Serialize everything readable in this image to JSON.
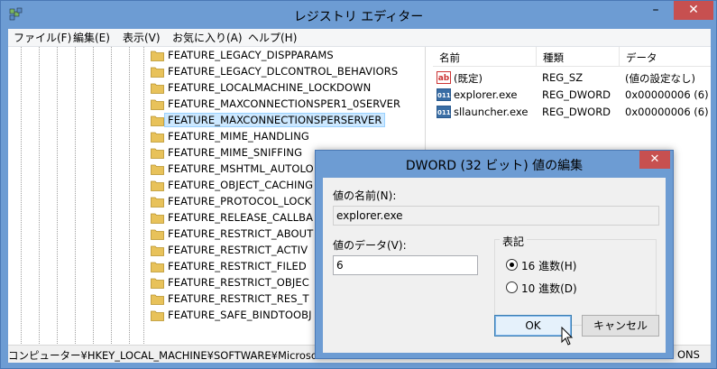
{
  "window": {
    "title": "レジストリ エディター",
    "minimize": "–",
    "maximize": "□",
    "close": "✕"
  },
  "menu": [
    "ファイル(F)",
    "編集(E)",
    "表示(V)",
    "お気に入り(A)",
    "ヘルプ(H)"
  ],
  "tree": {
    "items": [
      "FEATURE_LEGACY_DISPPARAMS",
      "FEATURE_LEGACY_DLCONTROL_BEHAVIORS",
      "FEATURE_LOCALMACHINE_LOCKDOWN",
      "FEATURE_MAXCONNECTIONSPER1_0SERVER",
      "FEATURE_MAXCONNECTIONSPERSERVER",
      "FEATURE_MIME_HANDLING",
      "FEATURE_MIME_SNIFFING",
      "FEATURE_MSHTML_AUTOLO",
      "FEATURE_OBJECT_CACHING",
      "FEATURE_PROTOCOL_LOCK",
      "FEATURE_RELEASE_CALLBA",
      "FEATURE_RESTRICT_ABOUT",
      "FEATURE_RESTRICT_ACTIV",
      "FEATURE_RESTRICT_FILED",
      "FEATURE_RESTRICT_OBJEC",
      "FEATURE_RESTRICT_RES_T",
      "FEATURE_SAFE_BINDTOOBJ"
    ],
    "selected_index": 4
  },
  "list": {
    "headers": [
      "名前",
      "種類",
      "データ"
    ],
    "rows": [
      {
        "icon": "ab",
        "name": "(既定)",
        "type": "REG_SZ",
        "data": "(値の設定なし)"
      },
      {
        "icon": "011",
        "name": "explorer.exe",
        "type": "REG_DWORD",
        "data": "0x00000006 (6)"
      },
      {
        "icon": "011",
        "name": "sllauncher.exe",
        "type": "REG_DWORD",
        "data": "0x00000006 (6)"
      }
    ]
  },
  "status": {
    "path": "コンピューター¥HKEY_LOCAL_MACHINE¥SOFTWARE¥Microsof",
    "tail": "ONS"
  },
  "dialog": {
    "title": "DWORD (32 ビット) 値の編集",
    "close": "✕",
    "name_label": "値の名前(N):",
    "name_value": "explorer.exe",
    "data_label": "値のデータ(V):",
    "data_value": "6",
    "base_label": "表記",
    "hex_label": "16 進数(H)",
    "dec_label": "10 進数(D)",
    "base_selected": "hex",
    "ok": "OK",
    "cancel": "キャンセル"
  },
  "colors": {
    "title_bar": "#6d9cd3",
    "close_button": "#c75050",
    "selection": "#cce8ff",
    "folder": "#e8c25a"
  }
}
